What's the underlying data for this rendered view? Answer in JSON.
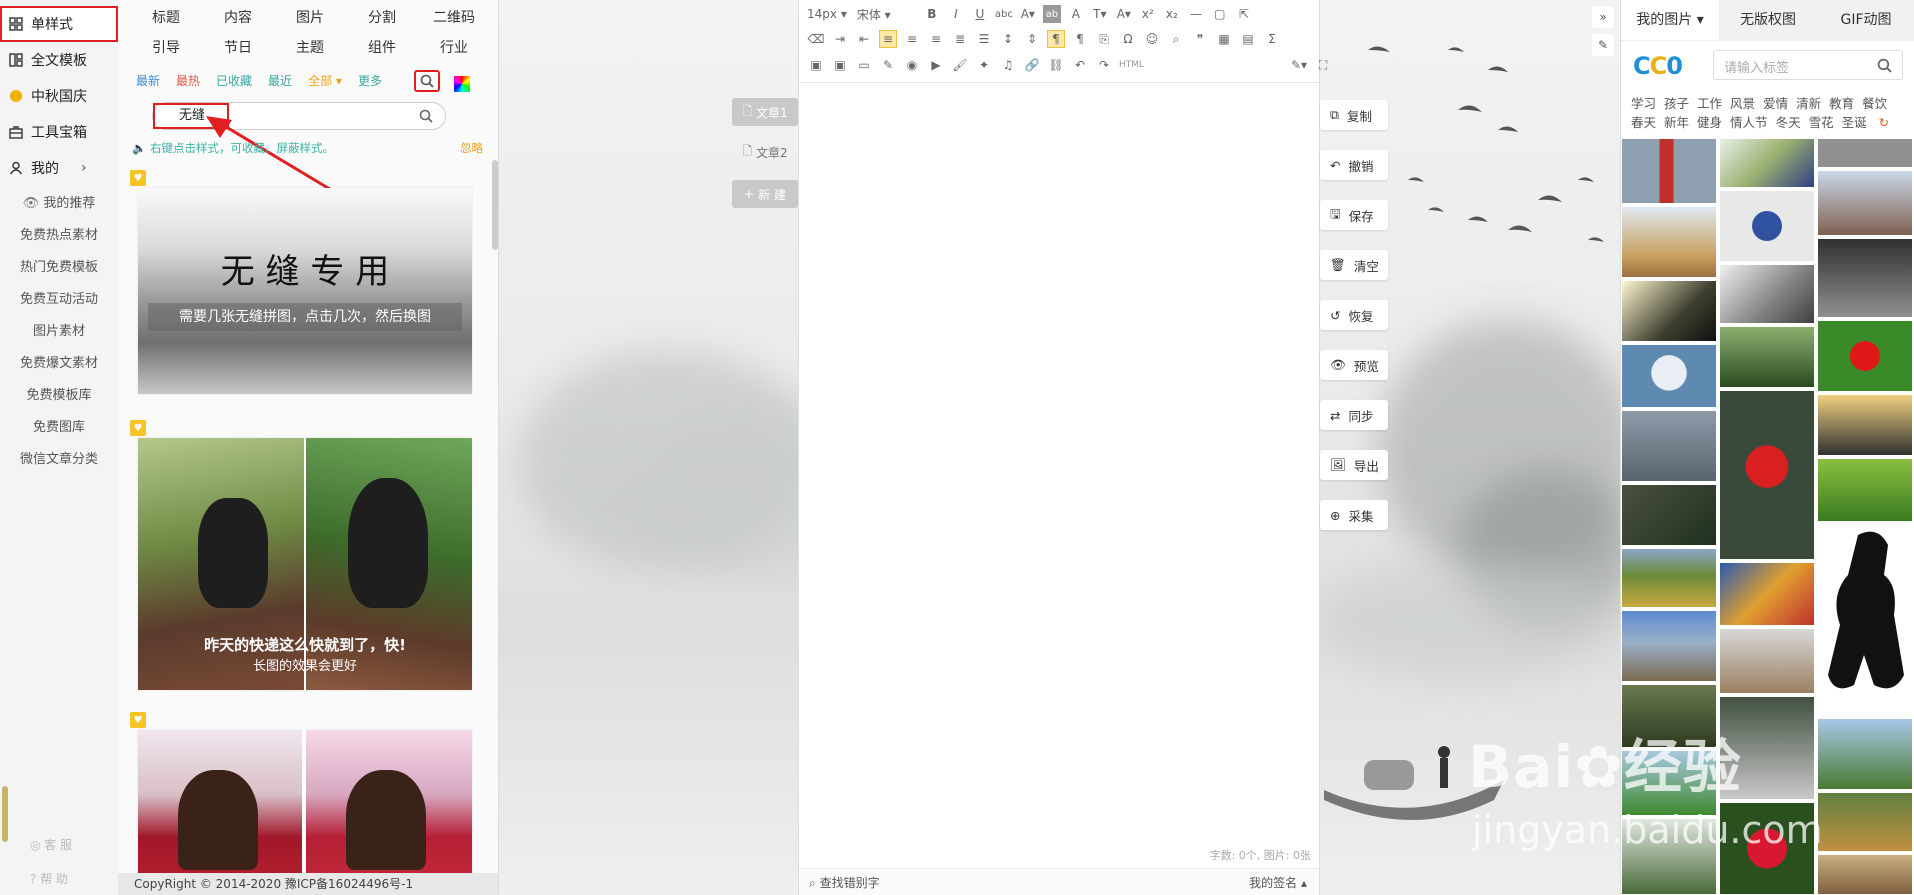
{
  "leftnav": {
    "items": [
      {
        "label": "单样式",
        "icon": "grid-icon"
      },
      {
        "label": "全文模板",
        "icon": "layout-icon"
      },
      {
        "label": "中秋国庆",
        "icon": "moon-icon"
      },
      {
        "label": "工具宝箱",
        "icon": "toolbox-icon"
      },
      {
        "label": "我的",
        "icon": "user-icon"
      }
    ],
    "subitems": [
      "我的推荐",
      "免费热点素材",
      "热门免费模板",
      "免费互动活动",
      "图片素材",
      "免费爆文素材",
      "免费模板库",
      "免费图库",
      "微信文章分类"
    ],
    "footer": [
      "客 服",
      "帮 助"
    ]
  },
  "stylepanel": {
    "categories": [
      "标题",
      "内容",
      "图片",
      "分割",
      "二维码",
      "引导",
      "节日",
      "主题",
      "组件",
      "行业"
    ],
    "filters": [
      {
        "label": "最新",
        "color": "#3b8fd6"
      },
      {
        "label": "最热",
        "color": "#e0584b"
      },
      {
        "label": "已收藏",
        "color": "#35a8a0"
      },
      {
        "label": "最近",
        "color": "#35a8a0"
      },
      {
        "label": "全部",
        "color": "#f0a020"
      },
      {
        "label": "更多",
        "color": "#35a8a0"
      }
    ],
    "search_value": "无缝",
    "hint": "右键点击样式，可收藏、屏蔽样式。",
    "hint_ignore": "忽略",
    "card1": {
      "title": "无 缝 专 用",
      "subtitle": "需要几张无缝拼图，点击几次，然后换图"
    },
    "card2": {
      "line1": "昨天的快递这么快就到了，快!",
      "line2": "长图的效果会更好"
    },
    "copyright": "CopyRight © 2014-2020 豫ICP备16024496号-1"
  },
  "doc_tabs": [
    {
      "label": "文章1"
    },
    {
      "label": "文章2"
    },
    {
      "label": "新 建"
    }
  ],
  "editor": {
    "font_size": "14px",
    "font_family": "宋体",
    "html_label": "HTML",
    "status": "字数: 0个, 图片: 0张",
    "find_typo": "查找错别字",
    "signature": "我的签名"
  },
  "actions": [
    "复制",
    "撤销",
    "保存",
    "清空",
    "恢复",
    "预览",
    "同步",
    "导出",
    "采集"
  ],
  "imgpanel": {
    "tabs": [
      "我的图片",
      "无版权图",
      "GIF动图"
    ],
    "logo": "CC0",
    "tag_placeholder": "请输入标签",
    "tags": [
      "学习",
      "孩子",
      "工作",
      "风景",
      "爱情",
      "清新",
      "教育",
      "餐饮",
      "春天",
      "新年",
      "健身",
      "情人节",
      "冬天",
      "雪花",
      "圣诞"
    ]
  },
  "watermark": {
    "line1": "Bai",
    "line1b": "经验",
    "line2": "jingyan.baidu.com"
  },
  "colors": {
    "accent_red": "#e02020",
    "teal": "#3bb3a4",
    "badge": "#f7c423"
  }
}
